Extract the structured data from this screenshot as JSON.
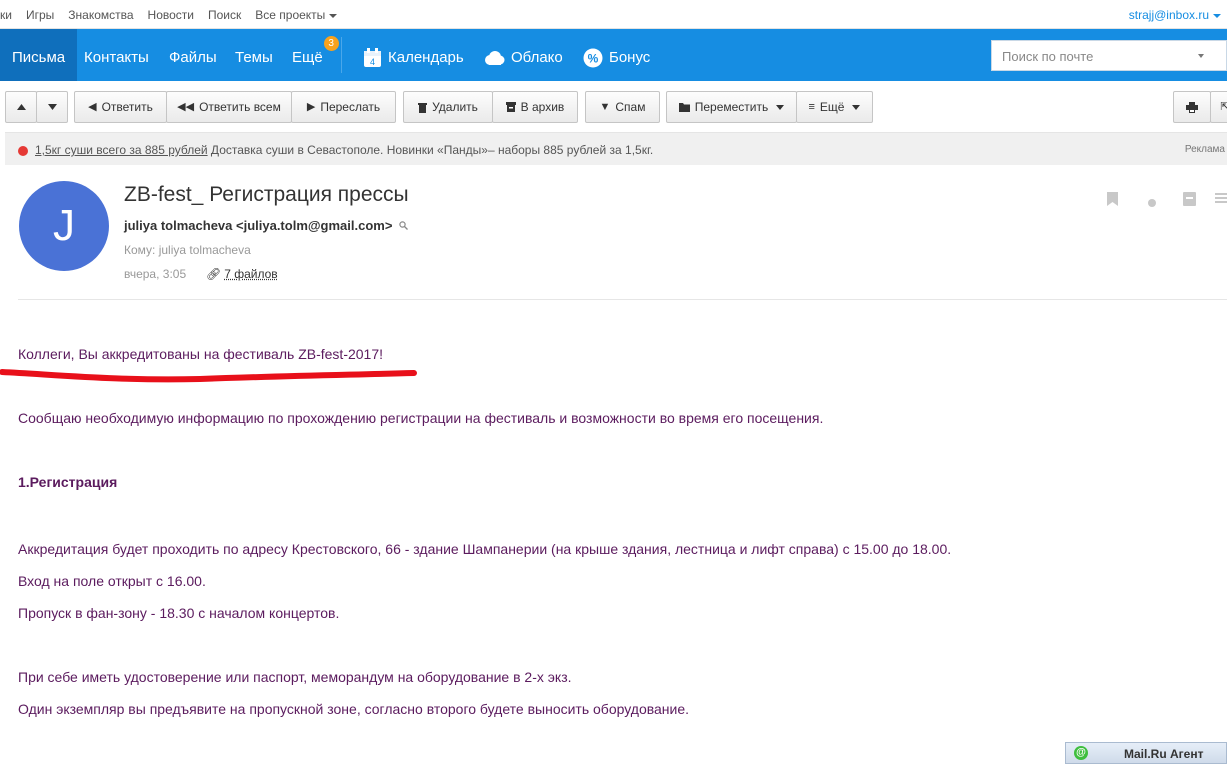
{
  "portal": {
    "links": [
      "ки",
      "Игры",
      "Знакомства",
      "Новости",
      "Поиск",
      "Все проекты"
    ],
    "user": "strajj@inbox.ru"
  },
  "nav": {
    "items": [
      "Письма",
      "Контакты",
      "Файлы",
      "Темы",
      "Ещё"
    ],
    "badge": "3",
    "calendar": "Календарь",
    "calendar_day": "4",
    "cloud": "Облако",
    "bonus": "Бонус",
    "search_placeholder": "Поиск по почте"
  },
  "toolbar": {
    "reply": "Ответить",
    "reply_all": "Ответить всем",
    "forward": "Переслать",
    "delete": "Удалить",
    "archive": "В архив",
    "spam": "Спам",
    "move": "Переместить",
    "more": "Ещё"
  },
  "ad": {
    "link": "1,5кг суши всего за 885 рублей",
    "text": " Доставка суши в Севастополе. Новинки «Панды»– наборы 885 рублей за 1,5кг.",
    "label": "Реклама"
  },
  "message": {
    "avatar_letter": "J",
    "subject": "ZB-fest_ Регистрация прессы",
    "from": "juliya tolmacheva <juliya.tolm@gmail.com>",
    "to": "Кому: juliya tolmacheva",
    "date": "вчера, 3:05",
    "files": "7 файлов"
  },
  "body": {
    "line1": "Коллеги, Вы аккредитованы на фестиваль ZB-fest-2017!",
    "line2": "Сообщаю необходимую информацию по прохождению регистрации на фестиваль и возможности во время его посещения.",
    "heading": "1.Регистрация",
    "line3": "Аккредитация будет проходить по адресу Крестовского, 66 - здание Шампанерии (на крыше здания, лестница и лифт справа) с 15.00 до 18.00.",
    "line4": "Вход на поле открыт с 16.00.",
    "line5": "Пропуск в фан-зону - 18.30 с началом концертов.",
    "line6": "При себе иметь удостоверение или паспорт, меморандум на оборудование в 2-х экз.",
    "line7": "Один экземпляр вы предъявите на пропускной зоне, согласно второго будете выносить оборудование."
  },
  "agent": {
    "label": "Mail.Ru Агент"
  },
  "colors": {
    "nav_bg": "#168de2",
    "nav_active": "#0f6fbc",
    "avatar": "#4a72d6",
    "body_text": "#5b1b5e",
    "underline": "#e8101a"
  }
}
